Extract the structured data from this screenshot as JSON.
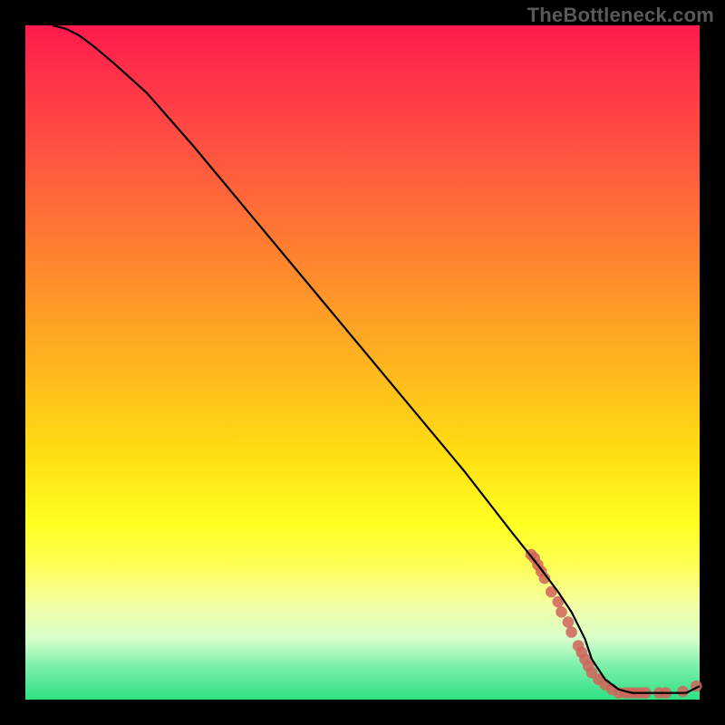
{
  "watermark": "TheBottleneck.com",
  "chart_data": {
    "type": "line",
    "title": "",
    "xlabel": "",
    "ylabel": "",
    "xlim": [
      0,
      100
    ],
    "ylim": [
      0,
      100
    ],
    "grid": false,
    "legend": false,
    "series": [
      {
        "name": "curve",
        "color": "#000000",
        "x": [
          4,
          6,
          8,
          10,
          13,
          18,
          25,
          35,
          45,
          55,
          65,
          72,
          76,
          79,
          81,
          83,
          84,
          86,
          88,
          90,
          92,
          95,
          98,
          100
        ],
        "y": [
          100,
          99.5,
          98.5,
          97,
          94.5,
          90,
          82,
          70,
          58,
          46,
          34,
          25,
          20,
          16,
          13,
          9,
          6,
          3,
          1.5,
          1,
          1,
          1,
          1,
          2
        ]
      }
    ],
    "markers": [
      {
        "name": "clustered-points",
        "color": "#d1635a",
        "radius_pct": 0.85,
        "points": [
          [
            75,
            21.5
          ],
          [
            75.5,
            21
          ],
          [
            76,
            20
          ],
          [
            76.5,
            19
          ],
          [
            77,
            18
          ],
          [
            78,
            16
          ],
          [
            79,
            14.5
          ],
          [
            79.5,
            13
          ],
          [
            80.5,
            11.5
          ],
          [
            81,
            10
          ],
          [
            82,
            8
          ],
          [
            82.5,
            7
          ],
          [
            83,
            6
          ],
          [
            83.5,
            5
          ],
          [
            84,
            4
          ],
          [
            85,
            3
          ],
          [
            86,
            2.2
          ],
          [
            87,
            1.5
          ],
          [
            88,
            1
          ],
          [
            89,
            1
          ],
          [
            89.8,
            1
          ],
          [
            90.5,
            1
          ],
          [
            91.3,
            1
          ],
          [
            92,
            1
          ],
          [
            94,
            1
          ],
          [
            95,
            1
          ],
          [
            97.5,
            1.2
          ],
          [
            99.5,
            2
          ]
        ]
      }
    ]
  }
}
